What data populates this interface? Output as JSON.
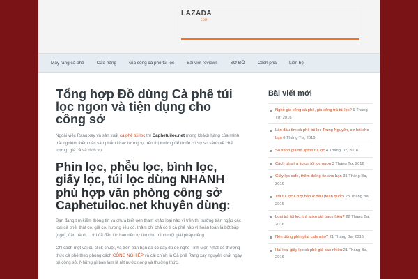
{
  "header": {
    "banner": {
      "brand": "LAZADA",
      "sub": "COM"
    }
  },
  "nav": {
    "items": [
      {
        "label": "Máy rang cà phê"
      },
      {
        "label": "Cửa hàng"
      },
      {
        "label": "Gia công cà phê túi lọc"
      },
      {
        "label": "Bài viết reviews"
      },
      {
        "label": "SƠ ĐỒ"
      },
      {
        "label": "Cách pha"
      },
      {
        "label": "Liên hệ"
      }
    ]
  },
  "post": {
    "title": "Tổng hợp Đồ dùng Cà phê túi lọc ngon và tiện dụng cho công sở",
    "intro_a": "Ngoài việc Rang xay và sản xuất ",
    "intro_link": "cà phê túi lọc",
    "intro_b": " thì ",
    "intro_strong": "Caphetuiloc.net",
    "intro_c": " mong khách hàng của mình trải nghiệm thêm các sản phẩm khác tương tự trên thị trường để từ đó có sự so sánh về chất lượng, giá cả và dịch vụ.",
    "heading": "Phin lọc, phễu lọc, bình lọc, giấy lọc, túi lọc dùng NHANH phù hợp văn phòng công sở Caphetuiloc.net khuyên dùng:",
    "para1": "Bạn đang tìm kiếm thông tin và chưa biết nên tham khảo loại nào vì trên thị trường tràn ngập các loại cà phê, thật có, giả có, hương liệu có, thậm chí chả có tí cà phê nào vì hoàn toàn là bột bắp (ngô), đậu nành.... thì đã đến lúc bạn nên tự tìm cho mình một giải pháp riêng.",
    "para2_a": "Chỉ cách một vài cú click chuột, và trên bàn bạn đã có đầy đủ đồ nghề Tinh Gọn Nhất để thưởng thức cà phê theo phong cách ",
    "para2_link": "CÔNG NGHIỆP",
    "para2_b": " và cái chính là Cà phê Rang xay nguyên chất ngay tại công sở. Những gì bạn làm là rất nước nóng và thưởng thức."
  },
  "sidebar": {
    "title": "Bài viết mới",
    "items": [
      {
        "link": "Nghề gia công cà phê, gia công trà túi lọc?",
        "date": " 9 Tháng Tư, 2016"
      },
      {
        "link": "Lần đầu tìm cà phê túi lọc Trung Nguyên, cơ hội cho bạn",
        "date": " 6 Tháng Tư, 2016"
      },
      {
        "link": "So sánh giá trà lipton túi lọc",
        "date": " 4 Tháng Tư, 2016"
      },
      {
        "link": "Cách pha trà lipton túi lọc ngon",
        "date": " 3 Tháng Tư, 2016"
      },
      {
        "link": "Giấy lọc cafe, thêm thông tin cho bạn",
        "date": " 31 Tháng Ba, 2016"
      },
      {
        "link": "Trà túi lọc Cozy bán ở đâu (toàn quốc)",
        "date": " 28 Tháng Ba, 2016"
      },
      {
        "link": "Loại trà túi lọc, trà atiso giá bao nhiêu?",
        "date": " 22 Tháng Ba, 2016"
      },
      {
        "link": "Nên dùng phin pha cafe nào?",
        "date": " 21 Tháng Ba, 2016"
      },
      {
        "link": "Hai loại giấy lọc cà phê giá bao nhiêu",
        "date": " 21 Tháng Ba, 2016"
      }
    ]
  }
}
